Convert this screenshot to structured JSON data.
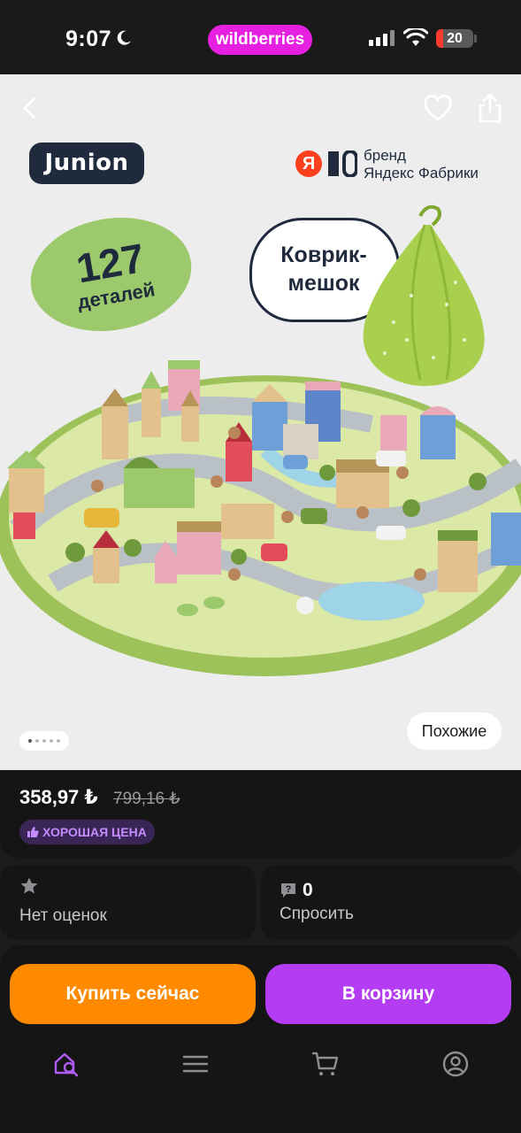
{
  "status_bar": {
    "time": "9:07",
    "app_pill": "wildberries",
    "battery": "20",
    "battery_level": 0.2
  },
  "hero": {
    "brand_logo": "Junion",
    "yandex_brand_line1": "бренд",
    "yandex_brand_line2": "Яндекс Фабрики",
    "yandex_letter": "Я",
    "pieces_count": "127",
    "pieces_label": "деталей",
    "bag_label_line1": "Коврик-",
    "bag_label_line2": "мешок",
    "similar_button": "Похожие",
    "carousel_total": 5,
    "carousel_active": 1
  },
  "product": {
    "price": "358,97 ₺",
    "old_price": "799,16 ₺",
    "price_badge": "ХОРОШАЯ ЦЕНА"
  },
  "rating": {
    "label": "Нет оценок"
  },
  "questions": {
    "count": "0",
    "label": "Спросить"
  },
  "actions": {
    "buy_now": "Купить сейчас",
    "add_to_cart": "В корзину"
  },
  "tab_bar": {
    "items": [
      "home-search-icon",
      "menu-icon",
      "cart-icon",
      "profile-icon"
    ],
    "active": "home-search-icon"
  },
  "colors": {
    "accent_purple": "#b43df4",
    "accent_orange": "#ff8a00",
    "brand_pill": "#e620e0",
    "badge_text": "#c58bff"
  }
}
